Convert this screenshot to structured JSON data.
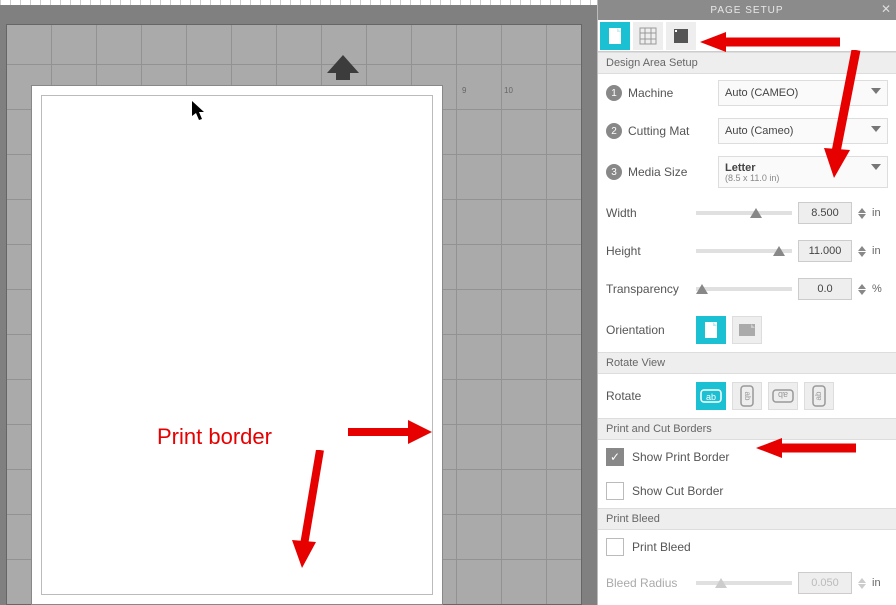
{
  "annotation": {
    "label": "Print border"
  },
  "panel": {
    "title": "PAGE SETUP",
    "design_area": {
      "heading": "Design Area Setup",
      "machine": {
        "num": "1",
        "label": "Machine",
        "value": "Auto (CAMEO)"
      },
      "cutting_mat": {
        "num": "2",
        "label": "Cutting Mat",
        "value": "Auto (Cameo)"
      },
      "media_size": {
        "num": "3",
        "label": "Media Size",
        "value": "Letter",
        "sub": "(8.5 x 11.0 in)"
      },
      "width": {
        "label": "Width",
        "value": "8.500",
        "unit": "in"
      },
      "height": {
        "label": "Height",
        "value": "11.000",
        "unit": "in"
      },
      "transparency": {
        "label": "Transparency",
        "value": "0.0",
        "unit": "%"
      },
      "orientation": {
        "label": "Orientation"
      }
    },
    "rotate_view": {
      "heading": "Rotate View",
      "label": "Rotate"
    },
    "borders": {
      "heading": "Print and Cut Borders",
      "show_print": "Show Print Border",
      "show_cut": "Show Cut Border"
    },
    "bleed": {
      "heading": "Print Bleed",
      "label": "Print Bleed",
      "radius_label": "Bleed Radius",
      "radius_value": "0.050",
      "radius_unit": "in"
    }
  },
  "ruler": {
    "n0": "9",
    "n1": "10"
  }
}
